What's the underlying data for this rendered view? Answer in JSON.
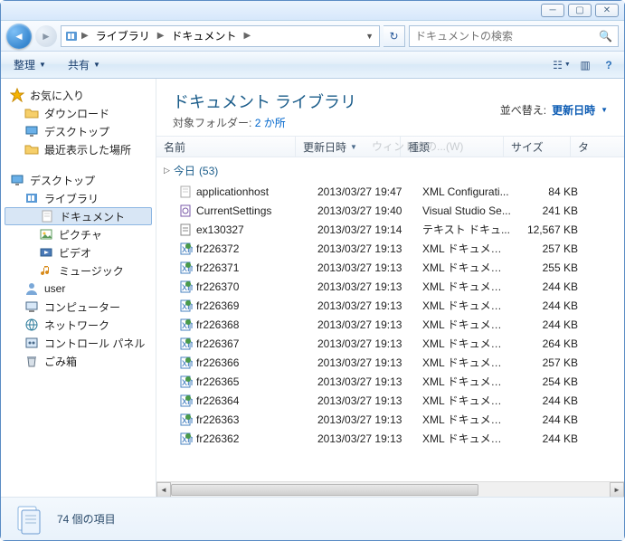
{
  "titlebar": {
    "min": "─",
    "max": "▢",
    "close": "✕"
  },
  "nav": {
    "breadcrumb": [
      {
        "label": "ライブラリ"
      },
      {
        "label": "ドキュメント"
      }
    ],
    "search_placeholder": "ドキュメントの検索"
  },
  "toolbar": {
    "organize": "整理",
    "share": "共有"
  },
  "sidebar": {
    "favorites": {
      "label": "お気に入り",
      "items": [
        {
          "label": "ダウンロード",
          "icon": "folder"
        },
        {
          "label": "デスクトップ",
          "icon": "monitor"
        },
        {
          "label": "最近表示した場所",
          "icon": "folder"
        }
      ]
    },
    "desktop": {
      "label": "デスクトップ",
      "libraries": {
        "label": "ライブラリ",
        "items": [
          {
            "label": "ドキュメント",
            "icon": "page",
            "selected": true
          },
          {
            "label": "ピクチャ",
            "icon": "pic"
          },
          {
            "label": "ビデオ",
            "icon": "vid"
          },
          {
            "label": "ミュージック",
            "icon": "music"
          }
        ]
      },
      "others": [
        {
          "label": "user",
          "icon": "user"
        },
        {
          "label": "コンピューター",
          "icon": "comp"
        },
        {
          "label": "ネットワーク",
          "icon": "net"
        },
        {
          "label": "コントロール パネル",
          "icon": "panel"
        },
        {
          "label": "ごみ箱",
          "icon": "trash"
        }
      ]
    }
  },
  "header": {
    "title": "ドキュメント ライブラリ",
    "subfolder_label": "対象フォルダー:",
    "subfolder_count": "2 か所",
    "arrange_label": "並べ替え:",
    "arrange_value": "更新日時"
  },
  "columns": {
    "name": "名前",
    "modified": "更新日時",
    "type": "種類",
    "size": "サイズ",
    "tag": "タ",
    "ghost_hint": "ウィンドウの...(W)"
  },
  "group": {
    "label": "今日",
    "count": "(53)"
  },
  "files": [
    {
      "name": "applicationhost",
      "date": "2013/03/27 19:47",
      "type": "XML Configurati...",
      "size": "84 KB",
      "icon": "page"
    },
    {
      "name": "CurrentSettings",
      "date": "2013/03/27 19:40",
      "type": "Visual Studio Se...",
      "size": "241 KB",
      "icon": "cfg"
    },
    {
      "name": "ex130327",
      "date": "2013/03/27 19:14",
      "type": "テキスト ドキュ...",
      "size": "12,567 KB",
      "icon": "txt"
    },
    {
      "name": "fr226372",
      "date": "2013/03/27 19:13",
      "type": "XML ドキュメント",
      "size": "257 KB",
      "icon": "xml"
    },
    {
      "name": "fr226371",
      "date": "2013/03/27 19:13",
      "type": "XML ドキュメント",
      "size": "255 KB",
      "icon": "xml"
    },
    {
      "name": "fr226370",
      "date": "2013/03/27 19:13",
      "type": "XML ドキュメント",
      "size": "244 KB",
      "icon": "xml"
    },
    {
      "name": "fr226369",
      "date": "2013/03/27 19:13",
      "type": "XML ドキュメント",
      "size": "244 KB",
      "icon": "xml"
    },
    {
      "name": "fr226368",
      "date": "2013/03/27 19:13",
      "type": "XML ドキュメント",
      "size": "244 KB",
      "icon": "xml"
    },
    {
      "name": "fr226367",
      "date": "2013/03/27 19:13",
      "type": "XML ドキュメント",
      "size": "264 KB",
      "icon": "xml"
    },
    {
      "name": "fr226366",
      "date": "2013/03/27 19:13",
      "type": "XML ドキュメント",
      "size": "257 KB",
      "icon": "xml"
    },
    {
      "name": "fr226365",
      "date": "2013/03/27 19:13",
      "type": "XML ドキュメント",
      "size": "254 KB",
      "icon": "xml"
    },
    {
      "name": "fr226364",
      "date": "2013/03/27 19:13",
      "type": "XML ドキュメント",
      "size": "244 KB",
      "icon": "xml"
    },
    {
      "name": "fr226363",
      "date": "2013/03/27 19:13",
      "type": "XML ドキュメント",
      "size": "244 KB",
      "icon": "xml"
    },
    {
      "name": "fr226362",
      "date": "2013/03/27 19:13",
      "type": "XML ドキュメント",
      "size": "244 KB",
      "icon": "xml"
    }
  ],
  "status": {
    "text": "74 個の項目"
  },
  "col_widths": {
    "name": "154px",
    "date": "116px",
    "type": "114px",
    "size": "74px",
    "tag": "28px"
  }
}
